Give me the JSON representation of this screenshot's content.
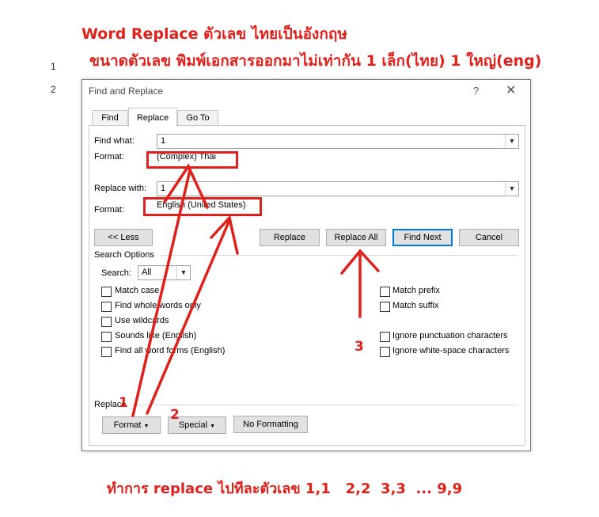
{
  "header": {
    "title": "Word Replace ตัวเลข ไทยเป็นอังกฤษ",
    "subtitle": "ขนาดตัวเลข พิมพ์เอกสารออกมาไม่เท่ากัน 1 เล็ก(ไทย) 1 ใหญ่(eng)"
  },
  "line_numbers": [
    "1",
    "2"
  ],
  "dialog": {
    "title": "Find and Replace",
    "help": "?",
    "close": "✕",
    "tabs": [
      "Find",
      "Replace",
      "Go To"
    ],
    "active_tab": "Replace",
    "find_label": "Find what:",
    "find_value": "1",
    "find_format_label": "Format:",
    "find_format_value": "(Complex) Thai",
    "replace_label": "Replace with:",
    "replace_value": "1",
    "replace_format_label": "Format:",
    "replace_format_value": "English (United States)",
    "buttons": {
      "less": "<< Less",
      "replace": "Replace",
      "replace_all": "Replace All",
      "find_next": "Find Next",
      "cancel": "Cancel"
    },
    "search_options_label": "Search Options",
    "search_label": "Search:",
    "search_value": "All",
    "left_options": [
      "Match case",
      "Find whole words only",
      "Use wildcards",
      "Sounds like (English)",
      "Find all word forms (English)"
    ],
    "right_options": [
      "Match prefix",
      "Match suffix",
      "Ignore punctuation characters",
      "Ignore white-space characters"
    ],
    "replace_section_label": "Replace",
    "bottom_buttons": {
      "format": "Format",
      "special": "Special",
      "no_formatting": "No Formatting"
    }
  },
  "annotations": {
    "step1": "1",
    "step2": "2",
    "step3": "3",
    "footer": "ทำการ replace ไปทีละตัวเลข 1,1   2,2  3,3  ... 9,9"
  },
  "colors": {
    "annotation_red": "#e0211b",
    "default_button_border": "#0078d7"
  }
}
